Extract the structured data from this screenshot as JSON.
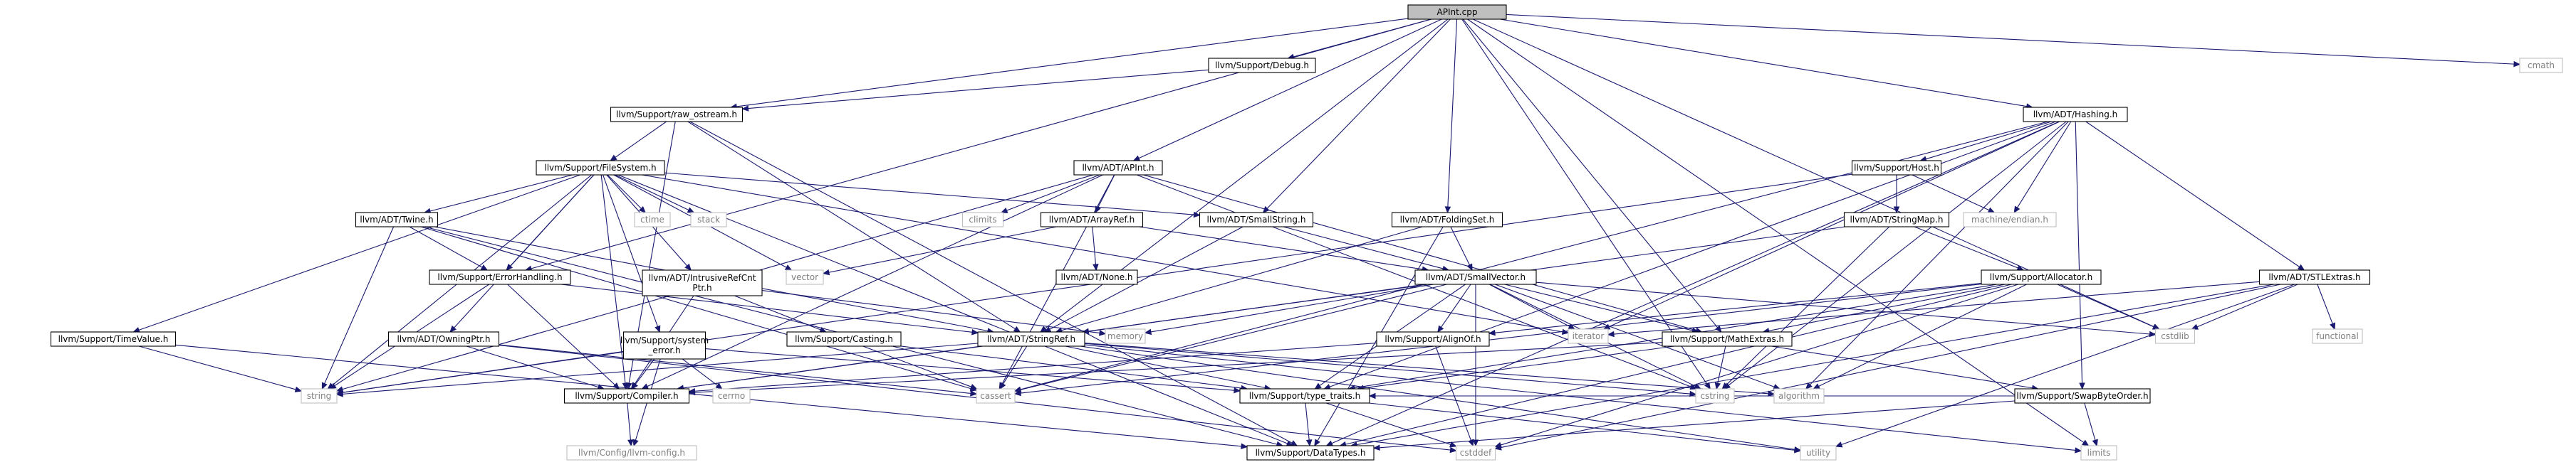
{
  "colors": {
    "edge": "#191970",
    "root_fill": "#bfbfbf",
    "internal_border": "#000000",
    "internal_text": "#000000",
    "system_border": "#bfbfbf",
    "system_text": "#7f7f7f"
  },
  "nodes": [
    {
      "id": "root",
      "label": "APInt.cpp",
      "kind": "root"
    },
    {
      "id": "debug",
      "label": "llvm/Support/Debug.h",
      "kind": "internal"
    },
    {
      "id": "cmath",
      "label": "cmath",
      "kind": "system"
    },
    {
      "id": "raw",
      "label": "llvm/Support/raw_ostream.h",
      "kind": "internal"
    },
    {
      "id": "hashing",
      "label": "llvm/ADT/Hashing.h",
      "kind": "internal"
    },
    {
      "id": "fs",
      "label": "llvm/Support/FileSystem.h",
      "kind": "internal"
    },
    {
      "id": "apint",
      "label": "llvm/ADT/APInt.h",
      "kind": "internal"
    },
    {
      "id": "host",
      "label": "llvm/Support/Host.h",
      "kind": "internal"
    },
    {
      "id": "twine",
      "label": "llvm/ADT/Twine.h",
      "kind": "internal"
    },
    {
      "id": "ctime",
      "label": "ctime",
      "kind": "system"
    },
    {
      "id": "stack",
      "label": "stack",
      "kind": "system"
    },
    {
      "id": "climits",
      "label": "climits",
      "kind": "system"
    },
    {
      "id": "arrayref",
      "label": "llvm/ADT/ArrayRef.h",
      "kind": "internal"
    },
    {
      "id": "smallstring",
      "label": "llvm/ADT/SmallString.h",
      "kind": "internal"
    },
    {
      "id": "foldingset",
      "label": "llvm/ADT/FoldingSet.h",
      "kind": "internal"
    },
    {
      "id": "machine",
      "label": "machine/endian.h",
      "kind": "system"
    },
    {
      "id": "stringmap",
      "label": "llvm/ADT/StringMap.h",
      "kind": "internal"
    },
    {
      "id": "vector",
      "label": "vector",
      "kind": "system"
    },
    {
      "id": "errorh",
      "label": "llvm/Support/ErrorHandling.h",
      "kind": "internal"
    },
    {
      "id": "intrusive",
      "label": "llvm/ADT/IntrusiveRefCnt\nPtr.h",
      "kind": "internal"
    },
    {
      "id": "none",
      "label": "llvm/ADT/None.h",
      "kind": "internal"
    },
    {
      "id": "smallvec",
      "label": "llvm/ADT/SmallVector.h",
      "kind": "internal"
    },
    {
      "id": "allocator",
      "label": "llvm/Support/Allocator.h",
      "kind": "internal"
    },
    {
      "id": "stlextras",
      "label": "llvm/ADT/STLExtras.h",
      "kind": "internal"
    },
    {
      "id": "timevalue",
      "label": "llvm/Support/TimeValue.h",
      "kind": "internal"
    },
    {
      "id": "owningptr",
      "label": "llvm/ADT/OwningPtr.h",
      "kind": "internal"
    },
    {
      "id": "syserror",
      "label": "llvm/Support/system\n_error.h",
      "kind": "internal"
    },
    {
      "id": "casting",
      "label": "llvm/Support/Casting.h",
      "kind": "internal"
    },
    {
      "id": "stringref",
      "label": "llvm/ADT/StringRef.h",
      "kind": "internal"
    },
    {
      "id": "memory",
      "label": "memory",
      "kind": "system"
    },
    {
      "id": "alignof",
      "label": "llvm/Support/AlignOf.h",
      "kind": "internal"
    },
    {
      "id": "iterator",
      "label": "iterator",
      "kind": "system"
    },
    {
      "id": "mathextras",
      "label": "llvm/Support/MathExtras.h",
      "kind": "internal"
    },
    {
      "id": "cstdlib",
      "label": "cstdlib",
      "kind": "system"
    },
    {
      "id": "functional",
      "label": "functional",
      "kind": "system"
    },
    {
      "id": "string",
      "label": "string",
      "kind": "system"
    },
    {
      "id": "compiler",
      "label": "llvm/Support/Compiler.h",
      "kind": "internal"
    },
    {
      "id": "cerrno",
      "label": "cerrno",
      "kind": "system"
    },
    {
      "id": "cassert",
      "label": "cassert",
      "kind": "system"
    },
    {
      "id": "typetraits",
      "label": "llvm/Support/type_traits.h",
      "kind": "internal"
    },
    {
      "id": "algorithm",
      "label": "algorithm",
      "kind": "system"
    },
    {
      "id": "cstring",
      "label": "cstring",
      "kind": "system"
    },
    {
      "id": "swapbyte",
      "label": "llvm/Support/SwapByteOrder.h",
      "kind": "internal"
    },
    {
      "id": "llvmconfig",
      "label": "llvm/Config/llvm-config.h",
      "kind": "system"
    },
    {
      "id": "datatypes",
      "label": "llvm/Support/DataTypes.h",
      "kind": "internal"
    },
    {
      "id": "cstddef",
      "label": "cstddef",
      "kind": "system"
    },
    {
      "id": "utility",
      "label": "utility",
      "kind": "system"
    },
    {
      "id": "limits",
      "label": "limits",
      "kind": "system"
    }
  ],
  "edges": [
    [
      "root",
      "debug"
    ],
    [
      "root",
      "cmath"
    ],
    [
      "root",
      "raw"
    ],
    [
      "root",
      "hashing"
    ],
    [
      "root",
      "apint"
    ],
    [
      "root",
      "smallstring"
    ],
    [
      "root",
      "foldingset"
    ],
    [
      "root",
      "stringref"
    ],
    [
      "root",
      "mathextras"
    ],
    [
      "root",
      "errorh"
    ],
    [
      "root",
      "cstdlib"
    ],
    [
      "root",
      "cstring"
    ],
    [
      "root",
      "limits"
    ],
    [
      "debug",
      "raw"
    ],
    [
      "raw",
      "fs"
    ],
    [
      "raw",
      "compiler"
    ],
    [
      "raw",
      "stringref"
    ],
    [
      "raw",
      "datatypes"
    ],
    [
      "fs",
      "twine"
    ],
    [
      "fs",
      "ctime"
    ],
    [
      "fs",
      "stack"
    ],
    [
      "fs",
      "vector"
    ],
    [
      "fs",
      "errorh"
    ],
    [
      "fs",
      "intrusive"
    ],
    [
      "fs",
      "timevalue"
    ],
    [
      "fs",
      "owningptr"
    ],
    [
      "fs",
      "syserror"
    ],
    [
      "fs",
      "smallstring"
    ],
    [
      "fs",
      "iterator"
    ],
    [
      "fs",
      "string"
    ],
    [
      "fs",
      "datatypes"
    ],
    [
      "fs",
      "compiler"
    ],
    [
      "twine",
      "stringref"
    ],
    [
      "twine",
      "errorh"
    ],
    [
      "twine",
      "string"
    ],
    [
      "twine",
      "cassert"
    ],
    [
      "twine",
      "datatypes"
    ],
    [
      "apint",
      "climits"
    ],
    [
      "apint",
      "arrayref"
    ],
    [
      "apint",
      "mathextras"
    ],
    [
      "apint",
      "cassert"
    ],
    [
      "apint",
      "string"
    ],
    [
      "apint",
      "cstring"
    ],
    [
      "apint",
      "compiler"
    ],
    [
      "arrayref",
      "none"
    ],
    [
      "arrayref",
      "smallvec"
    ],
    [
      "arrayref",
      "vector"
    ],
    [
      "smallstring",
      "smallvec"
    ],
    [
      "smallstring",
      "stringref"
    ],
    [
      "foldingset",
      "smallvec"
    ],
    [
      "foldingset",
      "stringref"
    ],
    [
      "foldingset",
      "datatypes"
    ],
    [
      "hashing",
      "host"
    ],
    [
      "hashing",
      "stlextras"
    ],
    [
      "hashing",
      "machine"
    ],
    [
      "hashing",
      "swapbyte"
    ],
    [
      "hashing",
      "algorithm"
    ],
    [
      "hashing",
      "cassert"
    ],
    [
      "hashing",
      "cstring"
    ],
    [
      "hashing",
      "iterator"
    ],
    [
      "hashing",
      "datatypes"
    ],
    [
      "hashing",
      "typetraits"
    ],
    [
      "host",
      "stringmap"
    ],
    [
      "host",
      "machine"
    ],
    [
      "host",
      "string"
    ],
    [
      "stringmap",
      "allocator"
    ],
    [
      "stringmap",
      "stringref"
    ],
    [
      "stringmap",
      "cstring"
    ],
    [
      "allocator",
      "alignof"
    ],
    [
      "allocator",
      "mathextras"
    ],
    [
      "allocator",
      "cstdlib"
    ],
    [
      "allocator",
      "cstddef"
    ],
    [
      "allocator",
      "typetraits"
    ],
    [
      "allocator",
      "algorithm"
    ],
    [
      "allocator",
      "datatypes"
    ],
    [
      "allocator",
      "cassert"
    ],
    [
      "stlextras",
      "cstdlib"
    ],
    [
      "stlextras",
      "functional"
    ],
    [
      "stlextras",
      "iterator"
    ],
    [
      "stlextras",
      "utility"
    ],
    [
      "stlextras",
      "cstddef"
    ],
    [
      "stlextras",
      "datatypes"
    ],
    [
      "errorh",
      "compiler"
    ],
    [
      "errorh",
      "stringref"
    ],
    [
      "errorh",
      "string"
    ],
    [
      "intrusive",
      "casting"
    ],
    [
      "intrusive",
      "compiler"
    ],
    [
      "intrusive",
      "memory"
    ],
    [
      "smallvec",
      "alignof"
    ],
    [
      "smallvec",
      "compiler"
    ],
    [
      "smallvec",
      "mathextras"
    ],
    [
      "smallvec",
      "typetraits"
    ],
    [
      "smallvec",
      "algorithm"
    ],
    [
      "smallvec",
      "cassert"
    ],
    [
      "smallvec",
      "cstddef"
    ],
    [
      "smallvec",
      "cstdlib"
    ],
    [
      "smallvec",
      "cstring"
    ],
    [
      "smallvec",
      "iterator"
    ],
    [
      "smallvec",
      "memory"
    ],
    [
      "timevalue",
      "datatypes"
    ],
    [
      "timevalue",
      "string"
    ],
    [
      "owningptr",
      "compiler"
    ],
    [
      "owningptr",
      "cstddef"
    ],
    [
      "owningptr",
      "cassert"
    ],
    [
      "syserror",
      "compiler"
    ],
    [
      "syserror",
      "cerrno"
    ],
    [
      "syserror",
      "string"
    ],
    [
      "syserror",
      "typetraits"
    ],
    [
      "syserror",
      "llvmconfig"
    ],
    [
      "casting",
      "typetraits"
    ],
    [
      "casting",
      "cassert"
    ],
    [
      "stringref",
      "compiler"
    ],
    [
      "stringref",
      "typetraits"
    ],
    [
      "stringref",
      "algorithm"
    ],
    [
      "stringref",
      "cassert"
    ],
    [
      "stringref",
      "cstring"
    ],
    [
      "stringref",
      "limits"
    ],
    [
      "stringref",
      "string"
    ],
    [
      "stringref",
      "utility"
    ],
    [
      "alignof",
      "cstddef"
    ],
    [
      "alignof",
      "compiler"
    ],
    [
      "mathextras",
      "swapbyte"
    ],
    [
      "mathextras",
      "compiler"
    ],
    [
      "mathextras",
      "cstring"
    ],
    [
      "mathextras",
      "typetraits"
    ],
    [
      "swapbyte",
      "typetraits"
    ],
    [
      "swapbyte",
      "datatypes"
    ],
    [
      "swapbyte",
      "limits"
    ],
    [
      "compiler",
      "llvmconfig"
    ],
    [
      "typetraits",
      "datatypes"
    ],
    [
      "typetraits",
      "cstddef"
    ],
    [
      "typetraits",
      "utility"
    ]
  ]
}
